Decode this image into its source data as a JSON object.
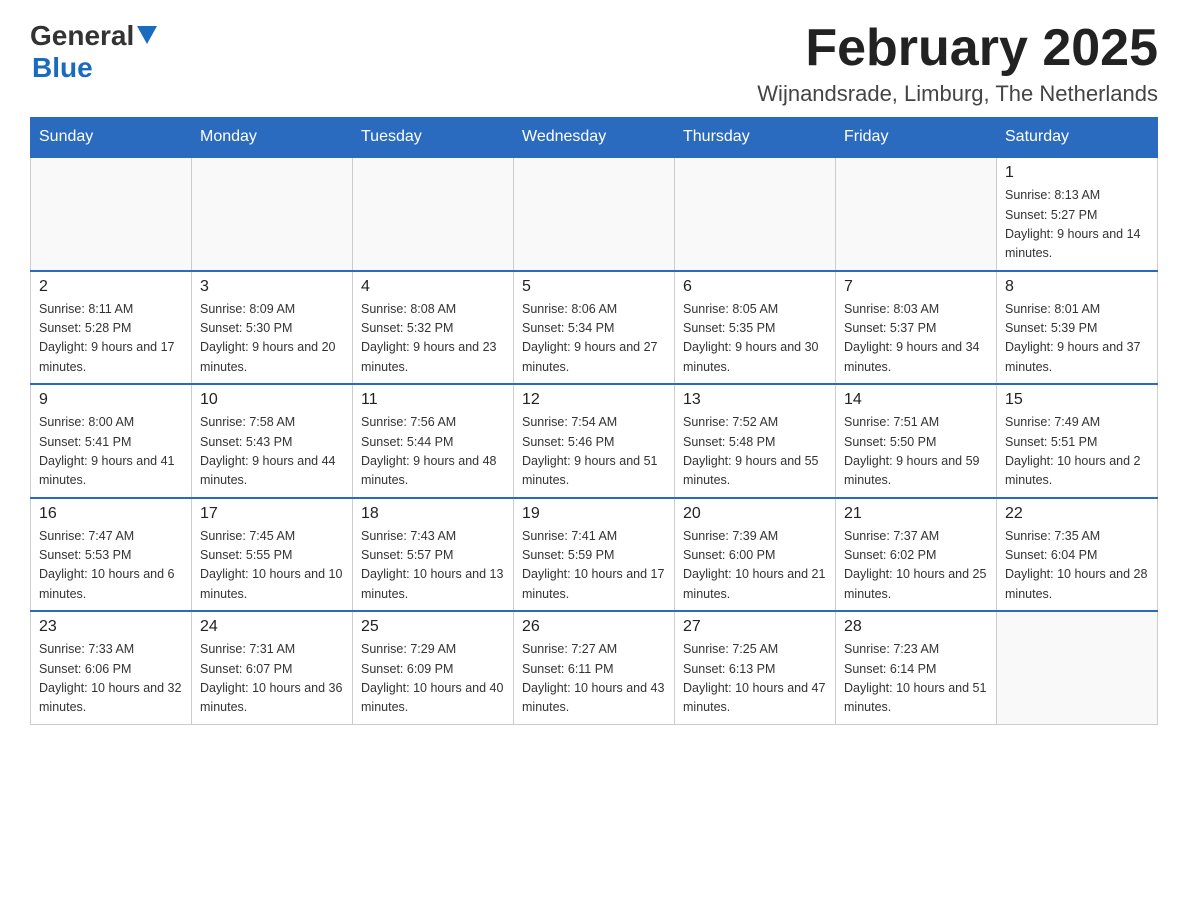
{
  "header": {
    "logo": {
      "general": "General",
      "blue": "Blue"
    },
    "title": "February 2025",
    "location": "Wijnandsrade, Limburg, The Netherlands"
  },
  "days_of_week": [
    "Sunday",
    "Monday",
    "Tuesday",
    "Wednesday",
    "Thursday",
    "Friday",
    "Saturday"
  ],
  "weeks": [
    [
      {
        "day": "",
        "info": ""
      },
      {
        "day": "",
        "info": ""
      },
      {
        "day": "",
        "info": ""
      },
      {
        "day": "",
        "info": ""
      },
      {
        "day": "",
        "info": ""
      },
      {
        "day": "",
        "info": ""
      },
      {
        "day": "1",
        "info": "Sunrise: 8:13 AM\nSunset: 5:27 PM\nDaylight: 9 hours and 14 minutes."
      }
    ],
    [
      {
        "day": "2",
        "info": "Sunrise: 8:11 AM\nSunset: 5:28 PM\nDaylight: 9 hours and 17 minutes."
      },
      {
        "day": "3",
        "info": "Sunrise: 8:09 AM\nSunset: 5:30 PM\nDaylight: 9 hours and 20 minutes."
      },
      {
        "day": "4",
        "info": "Sunrise: 8:08 AM\nSunset: 5:32 PM\nDaylight: 9 hours and 23 minutes."
      },
      {
        "day": "5",
        "info": "Sunrise: 8:06 AM\nSunset: 5:34 PM\nDaylight: 9 hours and 27 minutes."
      },
      {
        "day": "6",
        "info": "Sunrise: 8:05 AM\nSunset: 5:35 PM\nDaylight: 9 hours and 30 minutes."
      },
      {
        "day": "7",
        "info": "Sunrise: 8:03 AM\nSunset: 5:37 PM\nDaylight: 9 hours and 34 minutes."
      },
      {
        "day": "8",
        "info": "Sunrise: 8:01 AM\nSunset: 5:39 PM\nDaylight: 9 hours and 37 minutes."
      }
    ],
    [
      {
        "day": "9",
        "info": "Sunrise: 8:00 AM\nSunset: 5:41 PM\nDaylight: 9 hours and 41 minutes."
      },
      {
        "day": "10",
        "info": "Sunrise: 7:58 AM\nSunset: 5:43 PM\nDaylight: 9 hours and 44 minutes."
      },
      {
        "day": "11",
        "info": "Sunrise: 7:56 AM\nSunset: 5:44 PM\nDaylight: 9 hours and 48 minutes."
      },
      {
        "day": "12",
        "info": "Sunrise: 7:54 AM\nSunset: 5:46 PM\nDaylight: 9 hours and 51 minutes."
      },
      {
        "day": "13",
        "info": "Sunrise: 7:52 AM\nSunset: 5:48 PM\nDaylight: 9 hours and 55 minutes."
      },
      {
        "day": "14",
        "info": "Sunrise: 7:51 AM\nSunset: 5:50 PM\nDaylight: 9 hours and 59 minutes."
      },
      {
        "day": "15",
        "info": "Sunrise: 7:49 AM\nSunset: 5:51 PM\nDaylight: 10 hours and 2 minutes."
      }
    ],
    [
      {
        "day": "16",
        "info": "Sunrise: 7:47 AM\nSunset: 5:53 PM\nDaylight: 10 hours and 6 minutes."
      },
      {
        "day": "17",
        "info": "Sunrise: 7:45 AM\nSunset: 5:55 PM\nDaylight: 10 hours and 10 minutes."
      },
      {
        "day": "18",
        "info": "Sunrise: 7:43 AM\nSunset: 5:57 PM\nDaylight: 10 hours and 13 minutes."
      },
      {
        "day": "19",
        "info": "Sunrise: 7:41 AM\nSunset: 5:59 PM\nDaylight: 10 hours and 17 minutes."
      },
      {
        "day": "20",
        "info": "Sunrise: 7:39 AM\nSunset: 6:00 PM\nDaylight: 10 hours and 21 minutes."
      },
      {
        "day": "21",
        "info": "Sunrise: 7:37 AM\nSunset: 6:02 PM\nDaylight: 10 hours and 25 minutes."
      },
      {
        "day": "22",
        "info": "Sunrise: 7:35 AM\nSunset: 6:04 PM\nDaylight: 10 hours and 28 minutes."
      }
    ],
    [
      {
        "day": "23",
        "info": "Sunrise: 7:33 AM\nSunset: 6:06 PM\nDaylight: 10 hours and 32 minutes."
      },
      {
        "day": "24",
        "info": "Sunrise: 7:31 AM\nSunset: 6:07 PM\nDaylight: 10 hours and 36 minutes."
      },
      {
        "day": "25",
        "info": "Sunrise: 7:29 AM\nSunset: 6:09 PM\nDaylight: 10 hours and 40 minutes."
      },
      {
        "day": "26",
        "info": "Sunrise: 7:27 AM\nSunset: 6:11 PM\nDaylight: 10 hours and 43 minutes."
      },
      {
        "day": "27",
        "info": "Sunrise: 7:25 AM\nSunset: 6:13 PM\nDaylight: 10 hours and 47 minutes."
      },
      {
        "day": "28",
        "info": "Sunrise: 7:23 AM\nSunset: 6:14 PM\nDaylight: 10 hours and 51 minutes."
      },
      {
        "day": "",
        "info": ""
      }
    ]
  ]
}
